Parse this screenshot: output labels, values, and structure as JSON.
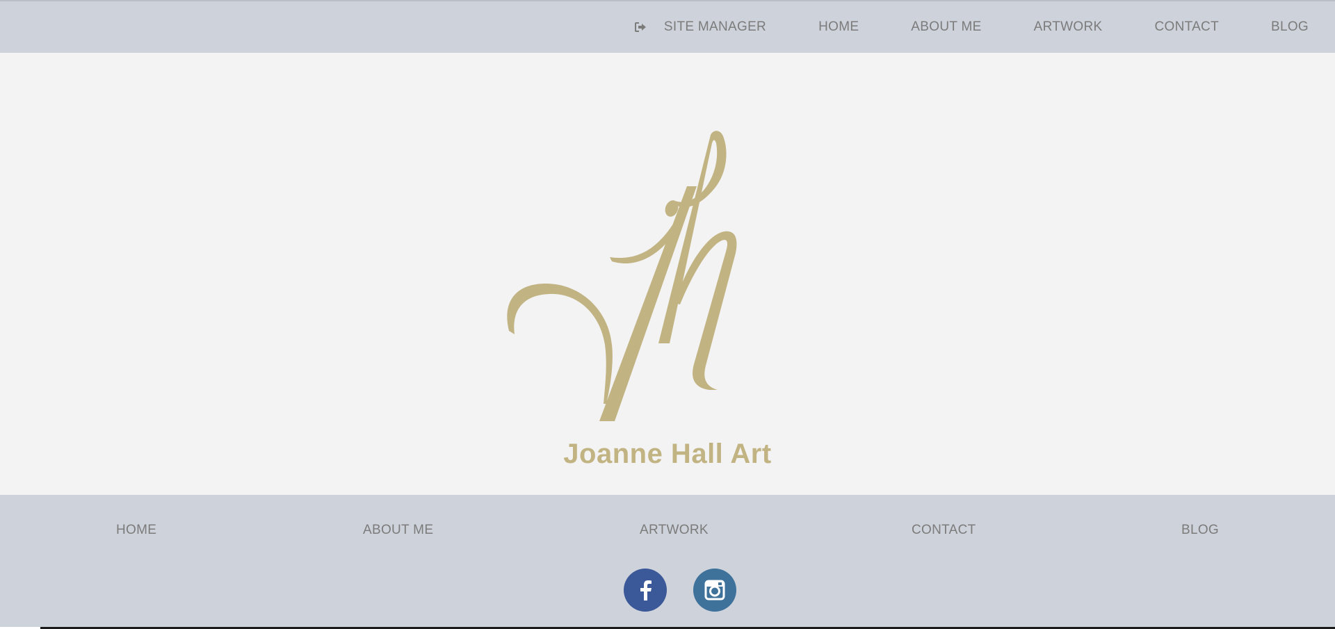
{
  "header": {
    "site_manager_label": "SITE MANAGER",
    "nav": [
      "HOME",
      "ABOUT ME",
      "ARTWORK",
      "CONTACT",
      "BLOG"
    ]
  },
  "hero": {
    "brand_name": "Joanne Hall Art",
    "logo_monogram": "jh"
  },
  "footer": {
    "nav": [
      "HOME",
      "ABOUT ME",
      "ARTWORK",
      "CONTACT",
      "BLOG"
    ],
    "social": [
      {
        "name": "facebook-icon",
        "color": "#3b5998"
      },
      {
        "name": "instagram-icon",
        "color": "#3f729b"
      }
    ]
  },
  "colors": {
    "header_bg": "#ced2db",
    "page_bg": "#f3f3f3",
    "brand_gold": "#c2b383",
    "nav_text": "#7b7b7b"
  }
}
